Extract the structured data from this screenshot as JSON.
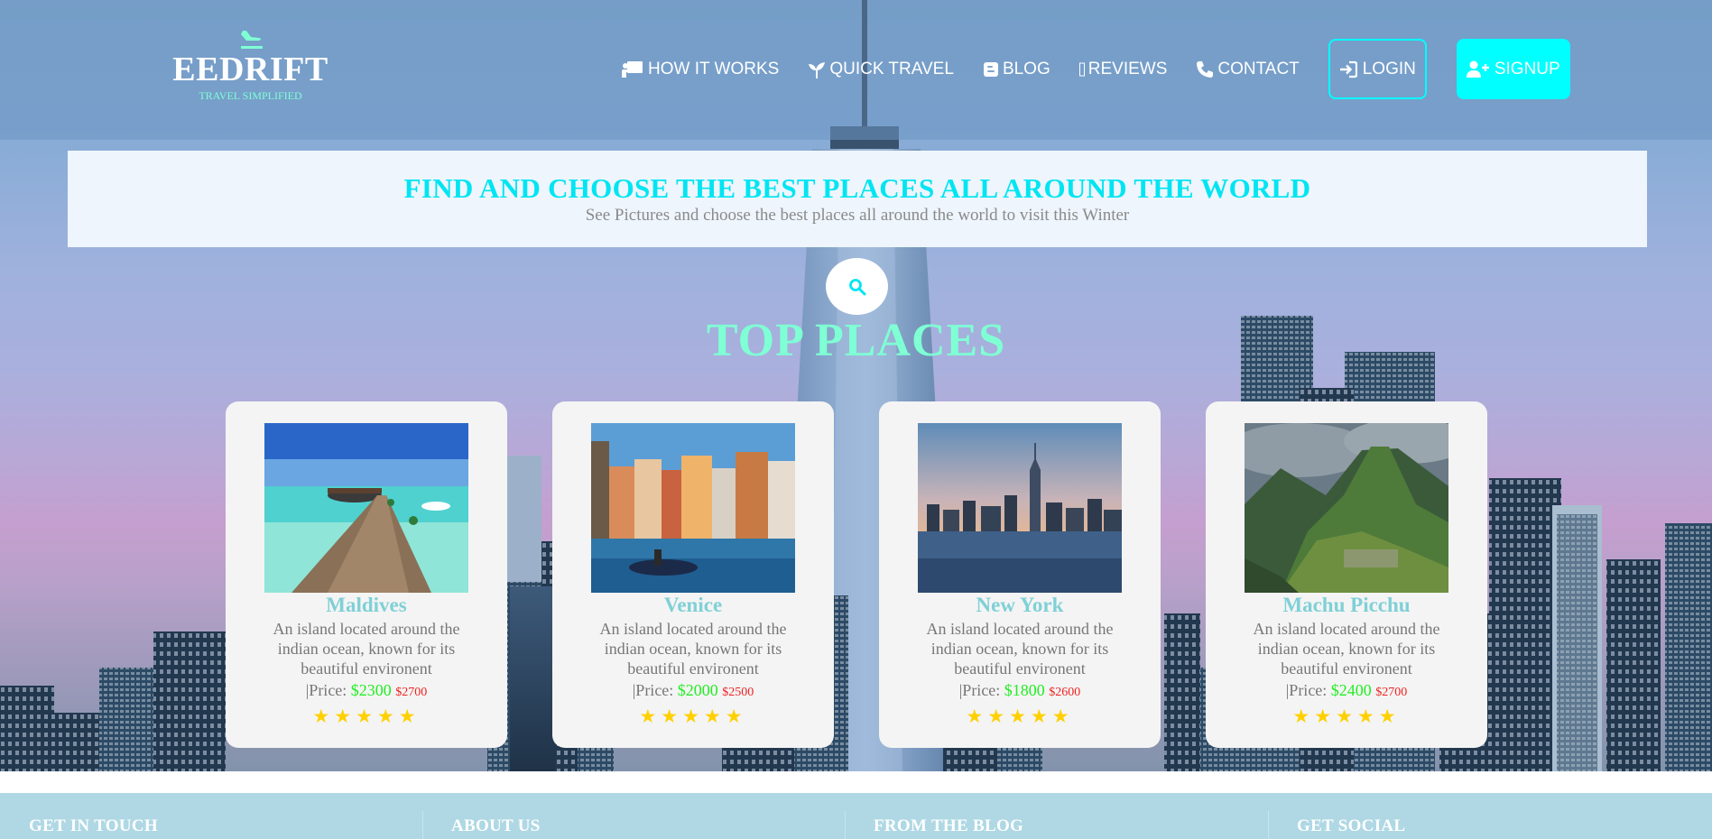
{
  "brand": {
    "name": "EEDRIFT",
    "tagline": "TRAVEL SIMPLIFIED"
  },
  "nav": {
    "items": [
      {
        "label": "HOW IT WORKS",
        "icon": "presentation-icon"
      },
      {
        "label": "QUICK TRAVEL",
        "icon": "seedling-icon"
      },
      {
        "label": "BLOG",
        "icon": "blogger-icon"
      },
      {
        "label": "REVIEWS",
        "icon": "missing-glyph-icon"
      },
      {
        "label": "CONTACT",
        "icon": "phone-icon"
      }
    ],
    "login_label": "LOGIN",
    "signup_label": "SIGNUP"
  },
  "banner": {
    "title": "FIND AND CHOOSE THE BEST PLACES ALL AROUND THE WORLD",
    "subtitle": "See Pictures and choose the best places all around the world to visit this Winter"
  },
  "section": {
    "title": "TOP PLACES"
  },
  "places": [
    {
      "name": "Maldives",
      "description": "An island located around the indian ocean, known for its beautiful environent",
      "price_label": "|Price:",
      "price": "$2300",
      "old_price": "$2700",
      "stars": "★★★★★",
      "rating": 5
    },
    {
      "name": "Venice",
      "description": "An island located around the indian ocean, known for its beautiful environent",
      "price_label": "|Price:",
      "price": "$2000",
      "old_price": "$2500",
      "stars": "★★★★★",
      "rating": 5
    },
    {
      "name": "New York",
      "description": "An island located around the indian ocean, known for its beautiful environent",
      "price_label": "|Price:",
      "price": "$1800",
      "old_price": "$2600",
      "stars": "★★★★★",
      "rating": 5
    },
    {
      "name": "Machu Picchu",
      "description": "An island located around the indian ocean, known for its beautiful environent",
      "price_label": "|Price:",
      "price": "$2400",
      "old_price": "$2700",
      "stars": "★★★★★",
      "rating": 5
    }
  ],
  "footer": {
    "columns": [
      "GET IN TOUCH",
      "ABOUT US",
      "FROM THE BLOG",
      "GET SOCIAL"
    ]
  },
  "colors": {
    "accent_cyan": "#00ffff",
    "title_aquamarine": "#7fffd4",
    "price_new": "#22ee22",
    "price_old": "#ee2222",
    "star": "#ffd000",
    "footer_bg": "#afd8e4"
  }
}
